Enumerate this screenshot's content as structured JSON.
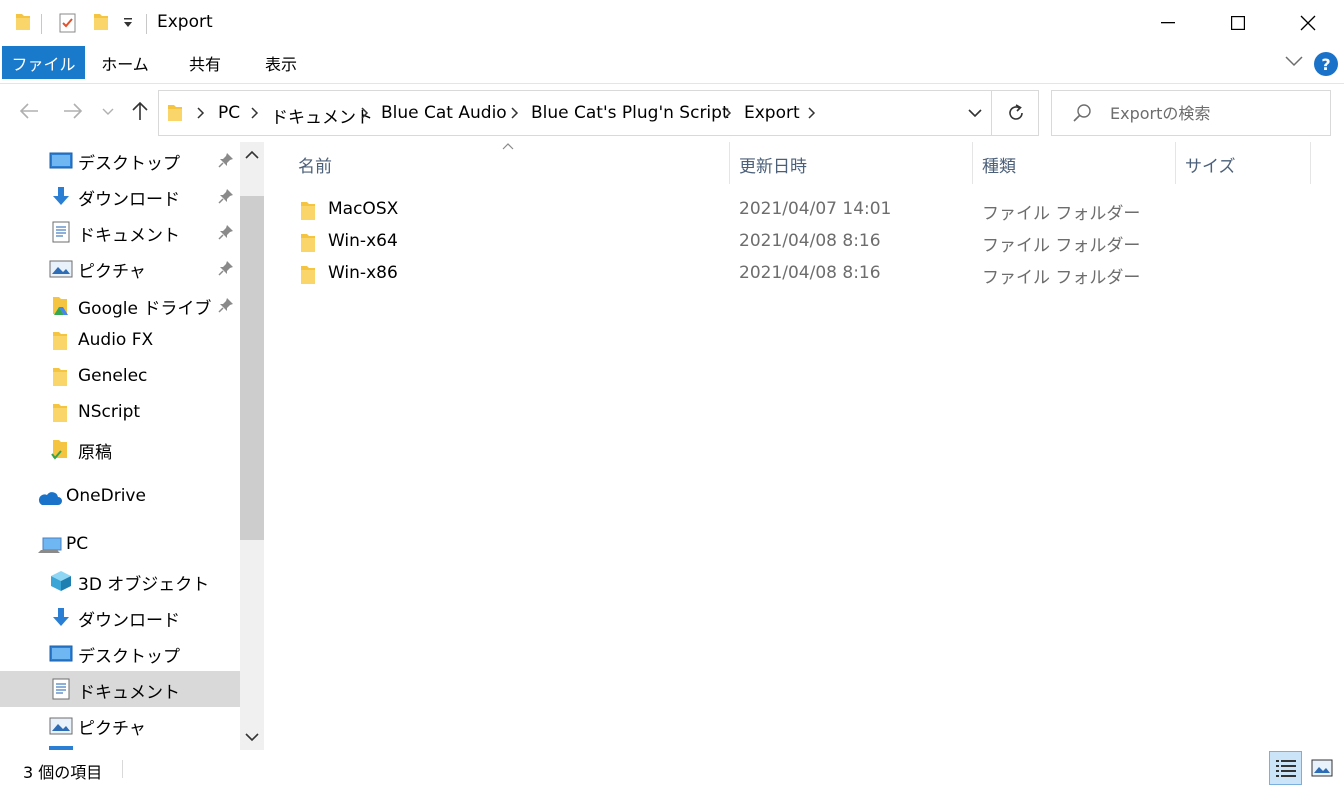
{
  "window": {
    "title": "Export"
  },
  "ribbon": {
    "tabs": [
      {
        "label": "ファイル"
      },
      {
        "label": "ホーム"
      },
      {
        "label": "共有"
      },
      {
        "label": "表示"
      }
    ],
    "help_label": "?"
  },
  "address": {
    "breadcrumbs": [
      "PC",
      "ドキュメント",
      "Blue Cat Audio",
      "Blue Cat's Plug'n Script",
      "Export"
    ]
  },
  "search": {
    "placeholder": "Exportの検索"
  },
  "sidebar": {
    "items": [
      {
        "label": "デスクトップ",
        "icon": "desktop-icon",
        "pinned": true
      },
      {
        "label": "ダウンロード",
        "icon": "download-icon",
        "pinned": true
      },
      {
        "label": "ドキュメント",
        "icon": "document-icon",
        "pinned": true
      },
      {
        "label": "ピクチャ",
        "icon": "picture-icon",
        "pinned": true
      },
      {
        "label": "Google ドライブ",
        "icon": "google-drive-folder-icon",
        "pinned": true
      },
      {
        "label": "Audio FX",
        "icon": "folder-icon"
      },
      {
        "label": "Genelec",
        "icon": "folder-icon"
      },
      {
        "label": "NScript",
        "icon": "folder-icon"
      },
      {
        "label": "原稿",
        "icon": "synced-folder-icon"
      },
      {
        "label": "OneDrive",
        "icon": "onedrive-icon"
      },
      {
        "label": "PC",
        "icon": "pc-icon"
      },
      {
        "label": "3D オブジェクト",
        "icon": "3d-objects-icon"
      },
      {
        "label": "ダウンロード",
        "icon": "download-icon"
      },
      {
        "label": "デスクトップ",
        "icon": "desktop-icon"
      },
      {
        "label": "ドキュメント",
        "icon": "document-icon",
        "selected": true
      },
      {
        "label": "ピクチャ",
        "icon": "picture-icon"
      }
    ]
  },
  "filelist": {
    "columns": {
      "name": "名前",
      "date": "更新日時",
      "type": "種類",
      "size": "サイズ"
    },
    "rows": [
      {
        "name": "MacOSX",
        "date": "2021/04/07 14:01",
        "type": "ファイル フォルダー"
      },
      {
        "name": "Win-x64",
        "date": "2021/04/08 8:16",
        "type": "ファイル フォルダー"
      },
      {
        "name": "Win-x86",
        "date": "2021/04/08 8:16",
        "type": "ファイル フォルダー"
      }
    ]
  },
  "status": {
    "item_count": "3 個の項目"
  },
  "colors": {
    "accent": "#1979ca",
    "folder": "#f5c542",
    "selected_bg": "#d9d9d9",
    "header_text": "#4c607a"
  }
}
